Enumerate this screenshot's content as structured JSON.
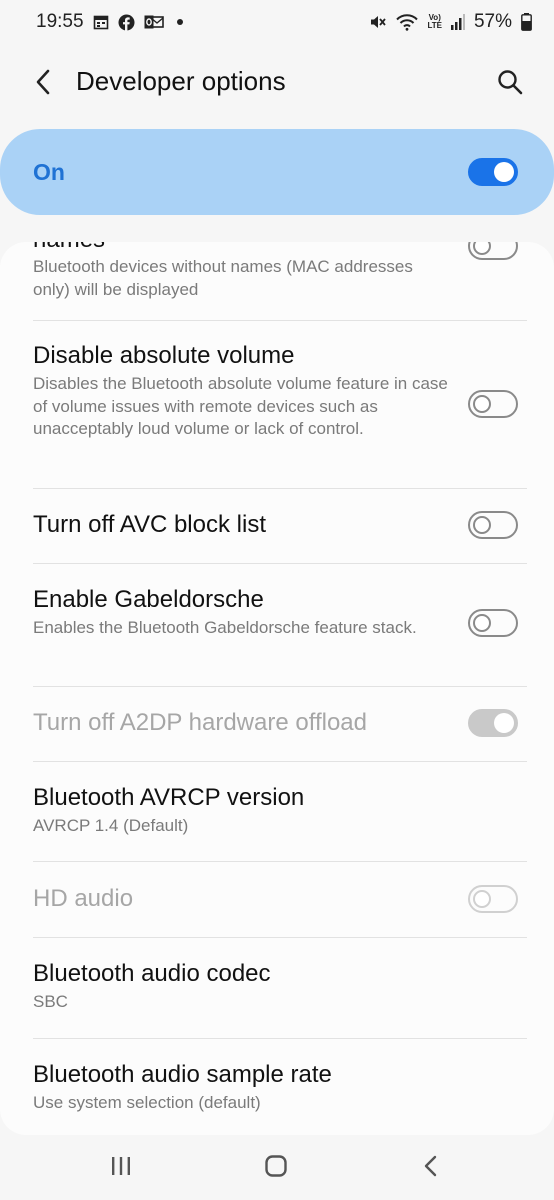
{
  "status_bar": {
    "time": "19:55",
    "battery": "57%",
    "lte_top": "Vo)",
    "lte_bottom": "LTE",
    "icons": [
      "calendar-icon",
      "facebook-icon",
      "outlook-icon",
      "dot-icon",
      "mute-icon",
      "wifi-icon",
      "volte-icon",
      "signal-icon",
      "battery-icon"
    ]
  },
  "header": {
    "title": "Developer options",
    "back_icon": "chevron-left-icon",
    "search_icon": "search-icon"
  },
  "master_switch": {
    "label": "On",
    "state": "on",
    "accent": "#1a73e8",
    "background": "#aad2f6"
  },
  "settings": [
    {
      "title": "names",
      "description": "Bluetooth devices without names (MAC addresses only) will be displayed",
      "toggle": "off"
    },
    {
      "title": "Disable absolute volume",
      "description": "Disables the Bluetooth absolute volume feature in case of volume issues with remote devices such as unacceptably loud volume or lack of control.",
      "toggle": "off"
    },
    {
      "title": "Turn off AVC block list",
      "description": "",
      "toggle": "off"
    },
    {
      "title": "Enable Gabeldorsche",
      "description": "Enables the Bluetooth Gabeldorsche feature stack.",
      "toggle": "off"
    },
    {
      "title": "Turn off A2DP hardware offload",
      "description": "",
      "toggle": "on-disabled"
    },
    {
      "title": "Bluetooth AVRCP version",
      "description": "AVRCP 1.4 (Default)"
    },
    {
      "title": "HD audio",
      "description": "",
      "toggle": "off-disabled"
    },
    {
      "title": "Bluetooth audio codec",
      "description": "SBC"
    },
    {
      "title": "Bluetooth audio sample rate",
      "description": "Use system selection (default)"
    }
  ],
  "nav_bar": {
    "recents_icon": "recents-icon",
    "home_icon": "home-icon",
    "back_icon": "back-icon"
  }
}
